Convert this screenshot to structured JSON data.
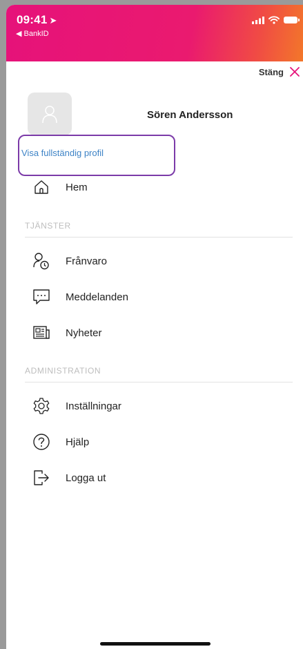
{
  "status_bar": {
    "time": "09:41",
    "time_icon": "location-arrow-icon",
    "back_app": "◀ BankID",
    "gradient_colors": [
      "#e6127a",
      "#f3772a"
    ]
  },
  "header": {
    "close_label": "Stäng",
    "close_icon": "close-icon",
    "close_color": "#e6127a"
  },
  "profile": {
    "name": "Sören Andersson",
    "view_profile_link": "Visa fullständig profil",
    "link_color": "#3d83c6",
    "highlight_color": "#7b3aa8"
  },
  "menu": {
    "home": {
      "label": "Hem",
      "icon": "home-icon"
    },
    "sections": [
      {
        "title": "TJÄNSTER",
        "items": [
          {
            "label": "Frånvaro",
            "icon": "person-clock-icon"
          },
          {
            "label": "Meddelanden",
            "icon": "chat-bubble-icon"
          },
          {
            "label": "Nyheter",
            "icon": "newspaper-icon"
          }
        ]
      },
      {
        "title": "ADMINISTRATION",
        "items": [
          {
            "label": "Inställningar",
            "icon": "gear-icon"
          },
          {
            "label": "Hjälp",
            "icon": "help-icon"
          },
          {
            "label": "Logga ut",
            "icon": "logout-icon"
          }
        ]
      }
    ]
  }
}
